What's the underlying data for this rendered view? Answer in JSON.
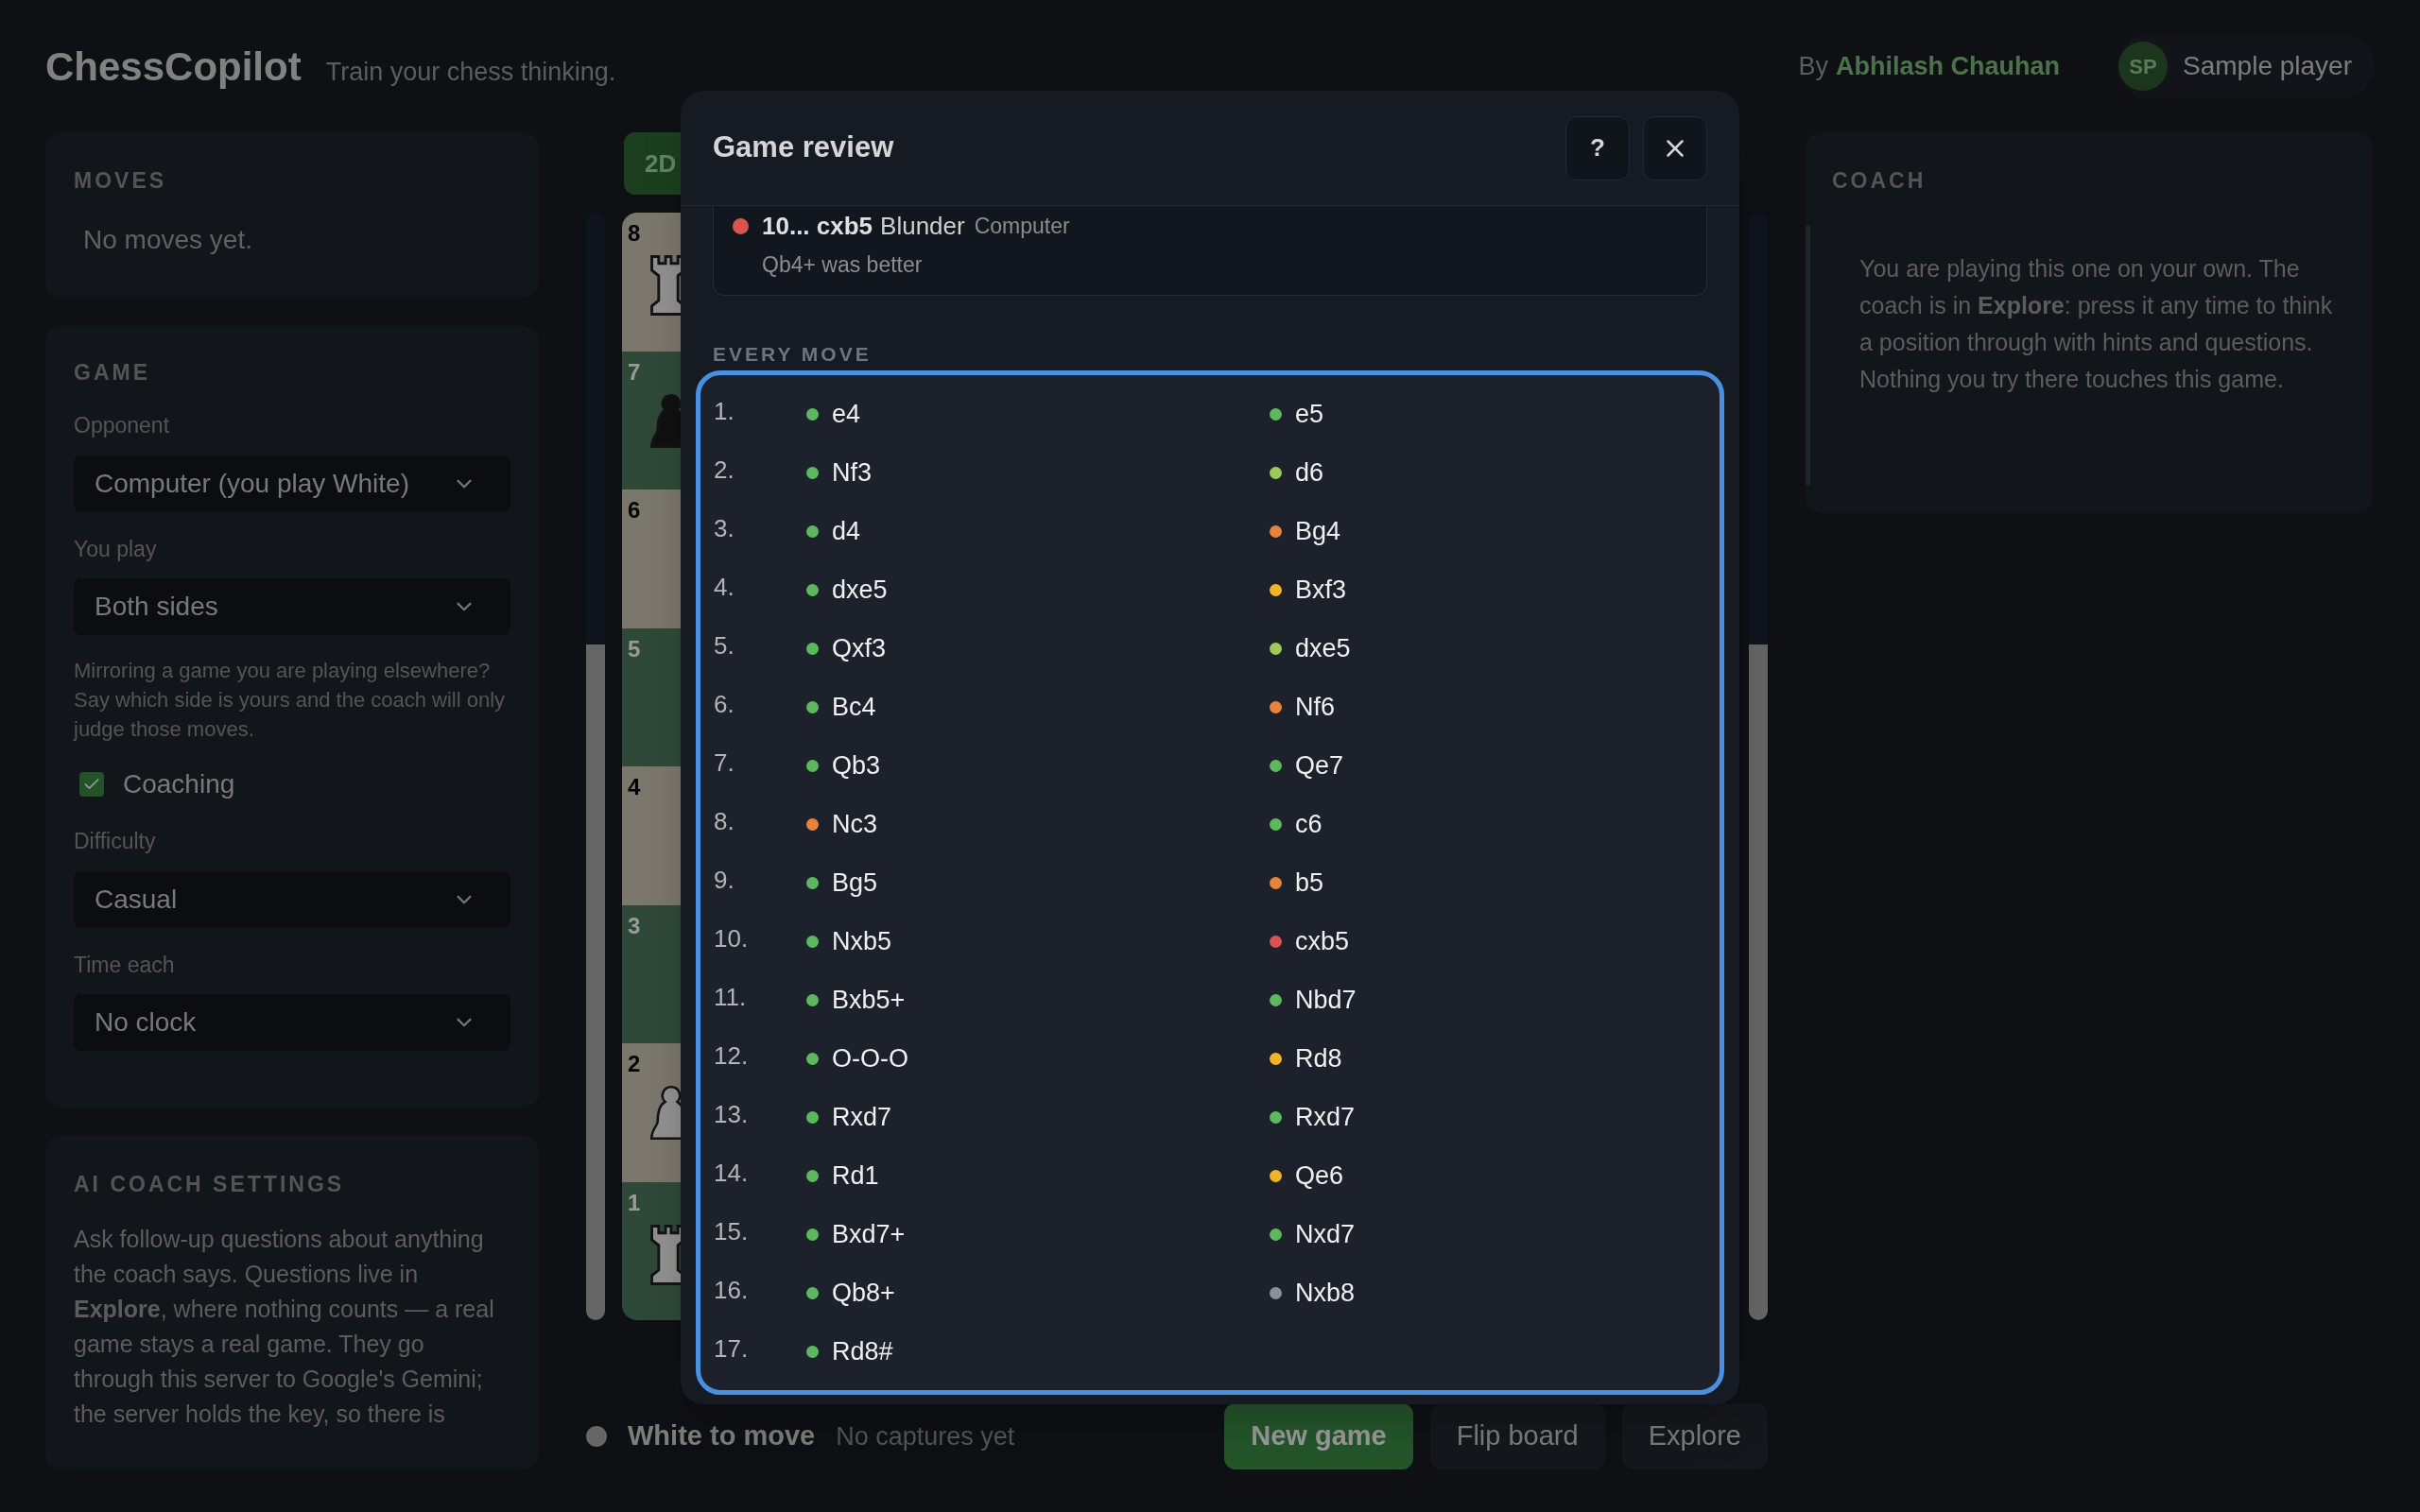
{
  "header": {
    "logo": "ChessCopilot",
    "tagline": "Train your chess thinking.",
    "byline_prefix": "By",
    "author": "Abhilash Chauhan",
    "user": {
      "initials": "SP",
      "name": "Sample player"
    }
  },
  "moves_panel": {
    "title": "MOVES",
    "empty_text": "No moves yet."
  },
  "game_panel": {
    "title": "GAME",
    "fields": [
      {
        "kind": "select",
        "label": "Opponent",
        "value": "Computer (you play White)"
      },
      {
        "kind": "select",
        "label": "You play",
        "value": "Both sides"
      },
      {
        "kind": "note",
        "text": "Mirroring a game you are playing elsewhere? Say which side is yours and the coach will only judge those moves."
      },
      {
        "kind": "checkbox",
        "label": "Coaching",
        "checked": true
      },
      {
        "kind": "select",
        "label": "Difficulty",
        "value": "Casual"
      },
      {
        "kind": "select",
        "label": "Time each",
        "value": "No clock"
      }
    ]
  },
  "ai_coach_panel": {
    "title": "AI COACH SETTINGS",
    "text": "Ask follow-up questions about anything the coach says. Questions live in **Explore**, where nothing counts — a real game stays a real game. They go through this server to Google's Gemini; the server holds the key, so there is"
  },
  "board": {
    "view_tab": {
      "label": "2D",
      "selected": true
    },
    "eval_bars": [
      {
        "level": 0.61
      },
      {
        "level": 0.61
      }
    ],
    "ranks": [
      {
        "label": "8",
        "piece": {
          "kind": "white-rook"
        }
      },
      {
        "label": "7",
        "piece": {
          "kind": "black-pawn"
        }
      },
      {
        "label": "6"
      },
      {
        "label": "5"
      },
      {
        "label": "4"
      },
      {
        "label": "3"
      },
      {
        "label": "2",
        "piece": {
          "kind": "white-pawn"
        }
      },
      {
        "label": "1",
        "piece": {
          "kind": "white-rook"
        }
      }
    ]
  },
  "status": {
    "turn": "White to move",
    "captures": "No captures yet",
    "buttons": [
      {
        "label": "New game",
        "kind": "primary"
      },
      {
        "label": "Flip board",
        "kind": "plain"
      },
      {
        "label": "Explore",
        "kind": "plain"
      }
    ]
  },
  "coach_panel": {
    "title": "COACH",
    "text": "You are playing this one on your own. The coach is in **Explore**: press it any time to think a position through with hints and questions. Nothing you try there touches this game."
  },
  "modal": {
    "title": "Game review",
    "help_label": "?",
    "review_item": {
      "color": "#d9534f",
      "move": "10... cxb5",
      "verdict": "Blunder",
      "side": "Computer",
      "note": "Qb4+ was better"
    },
    "section_title": "EVERY MOVE",
    "moves": [
      {
        "number": "1.",
        "white": {
          "san": "e4",
          "color": "#5cb85c"
        },
        "black": {
          "san": "e5",
          "color": "#5cb85c"
        }
      },
      {
        "number": "2.",
        "white": {
          "san": "Nf3",
          "color": "#5cb85c"
        },
        "black": {
          "san": "d6",
          "color": "#9cc95a"
        }
      },
      {
        "number": "3.",
        "white": {
          "san": "d4",
          "color": "#5cb85c"
        },
        "black": {
          "san": "Bg4",
          "color": "#e8843a"
        }
      },
      {
        "number": "4.",
        "white": {
          "san": "dxe5",
          "color": "#5cb85c"
        },
        "black": {
          "san": "Bxf3",
          "color": "#f0b429"
        }
      },
      {
        "number": "5.",
        "white": {
          "san": "Qxf3",
          "color": "#5cb85c"
        },
        "black": {
          "san": "dxe5",
          "color": "#9cc95a"
        }
      },
      {
        "number": "6.",
        "white": {
          "san": "Bc4",
          "color": "#5cb85c"
        },
        "black": {
          "san": "Nf6",
          "color": "#e8843a"
        }
      },
      {
        "number": "7.",
        "white": {
          "san": "Qb3",
          "color": "#5cb85c"
        },
        "black": {
          "san": "Qe7",
          "color": "#5cb85c"
        }
      },
      {
        "number": "8.",
        "white": {
          "san": "Nc3",
          "color": "#e8843a"
        },
        "black": {
          "san": "c6",
          "color": "#5cb85c"
        }
      },
      {
        "number": "9.",
        "white": {
          "san": "Bg5",
          "color": "#5cb85c"
        },
        "black": {
          "san": "b5",
          "color": "#e8843a"
        }
      },
      {
        "number": "10.",
        "white": {
          "san": "Nxb5",
          "color": "#5cb85c"
        },
        "black": {
          "san": "cxb5",
          "color": "#d9534f"
        }
      },
      {
        "number": "11.",
        "white": {
          "san": "Bxb5+",
          "color": "#5cb85c"
        },
        "black": {
          "san": "Nbd7",
          "color": "#5cb85c"
        }
      },
      {
        "number": "12.",
        "white": {
          "san": "O-O-O",
          "color": "#5cb85c"
        },
        "black": {
          "san": "Rd8",
          "color": "#f0b429"
        }
      },
      {
        "number": "13.",
        "white": {
          "san": "Rxd7",
          "color": "#5cb85c"
        },
        "black": {
          "san": "Rxd7",
          "color": "#5cb85c"
        }
      },
      {
        "number": "14.",
        "white": {
          "san": "Rd1",
          "color": "#5cb85c"
        },
        "black": {
          "san": "Qe6",
          "color": "#f0b429"
        }
      },
      {
        "number": "15.",
        "white": {
          "san": "Bxd7+",
          "color": "#5cb85c"
        },
        "black": {
          "san": "Nxd7",
          "color": "#5cb85c"
        }
      },
      {
        "number": "16.",
        "white": {
          "san": "Qb8+",
          "color": "#5cb85c"
        },
        "black": {
          "san": "Nxb8",
          "color": "#8a8f98"
        }
      },
      {
        "number": "17.",
        "white": {
          "san": "Rd8#",
          "color": "#5cb85c"
        }
      }
    ]
  }
}
